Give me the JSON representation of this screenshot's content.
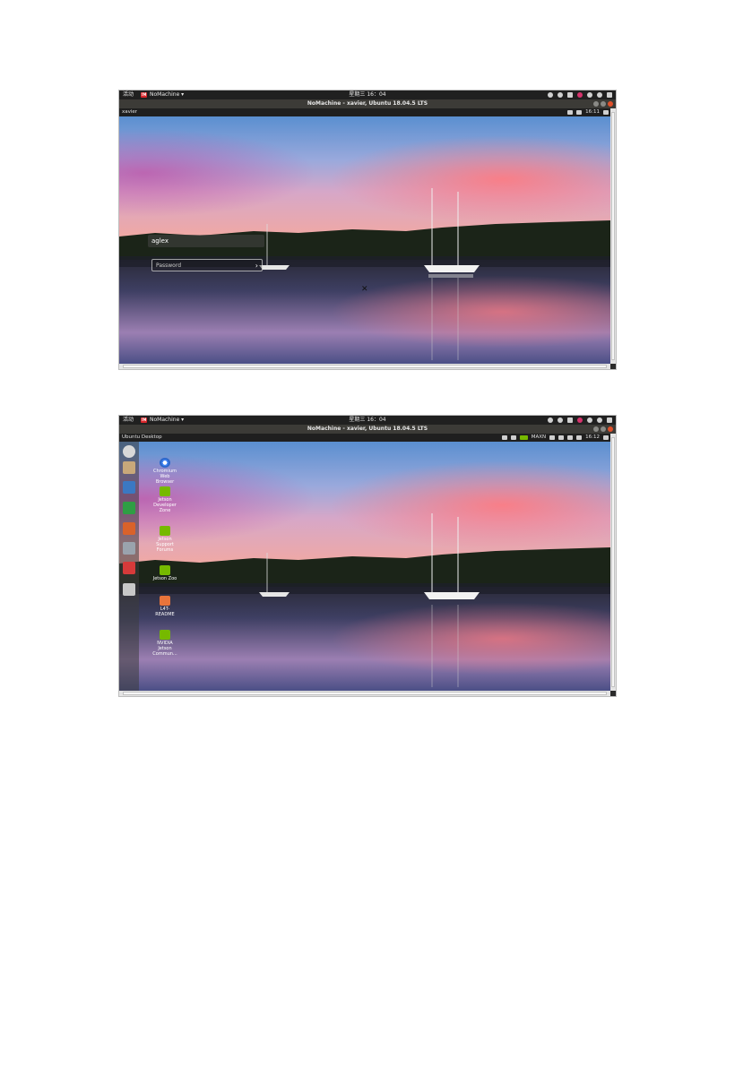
{
  "screenshots": [
    {
      "gnome_bar": {
        "activities": "活动",
        "app_name": "NoMachine ▾",
        "logo_text": "!M",
        "clock": "星期三 16：04"
      },
      "window_title": "NoMachine - xavier, Ubuntu 18.04.5 LTS",
      "ubuntu_bar": {
        "left": "xavier",
        "time": "16:11"
      },
      "login": {
        "username": "aglex",
        "password_placeholder": "Password"
      }
    },
    {
      "gnome_bar": {
        "activities": "活动",
        "app_name": "NoMachine ▾",
        "logo_text": "!M",
        "clock": "星期三 16：04"
      },
      "window_title": "NoMachine - xavier, Ubuntu 18.04.5 LTS",
      "ubuntu_bar": {
        "left": "Ubuntu Desktop",
        "power_mode": "MAXN",
        "time": "16:12"
      },
      "desktop_icons": [
        {
          "label": "Chromium Web Browser",
          "icon": "chromium-icon"
        },
        {
          "label": "Jetson Developer Zone",
          "icon": "nvidia-icon"
        },
        {
          "label": "Jetson Support Forums",
          "icon": "nvidia-icon"
        },
        {
          "label": "Jetson Zoo",
          "icon": "nvidia-icon"
        },
        {
          "label": "L4T-README",
          "icon": "folder-icon"
        },
        {
          "label": "NVIDIA Jetson Commun...",
          "icon": "nvidia-icon"
        }
      ],
      "launcher_items": [
        "ubuntu-dash-icon",
        "files-icon",
        "writer-icon",
        "calc-icon",
        "impress-icon",
        "settings-icon",
        "software-icon",
        "drive-icon"
      ]
    }
  ],
  "colors": {
    "nvidia_green": "#76b900",
    "close_button": "#e0502a",
    "nomachine_red": "#d9262b"
  }
}
